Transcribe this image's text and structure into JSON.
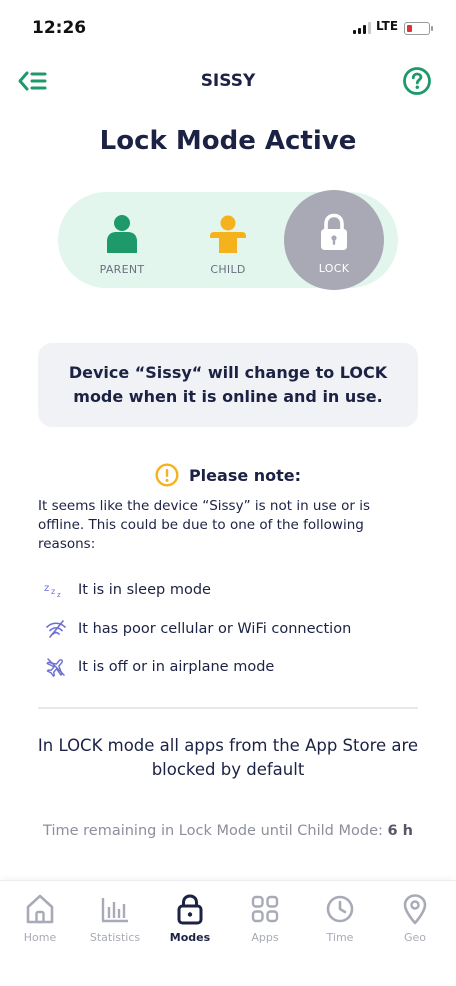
{
  "status_bar": {
    "time": "12:26",
    "network": "LTE"
  },
  "header": {
    "title": "SISSY",
    "back_icon": "menu-back-icon",
    "help_icon": "question-circle-icon"
  },
  "page_title": "Lock Mode Active",
  "modes": [
    {
      "label": "PARENT",
      "icon": "parent-person-icon",
      "color": "#1e9a6a"
    },
    {
      "label": "CHILD",
      "icon": "child-person-icon",
      "color": "#f5b21c"
    },
    {
      "label": "LOCK",
      "icon": "padlock-icon",
      "selected": true
    }
  ],
  "info_box": {
    "text": "Device “Sissy“ will change to LOCK mode when it is online and in use."
  },
  "note": {
    "title": "Please note:",
    "icon": "warning-circle-icon",
    "body": "It seems like the device “Sissy” is not in use or is offline. This could be due to one of the following reasons:",
    "reasons": [
      {
        "icon": "sleep-zzz-icon",
        "text": "It is in sleep mode"
      },
      {
        "icon": "no-wifi-icon",
        "text": "It has poor cellular or WiFi connection"
      },
      {
        "icon": "airplane-off-icon",
        "text": "It is off or in airplane mode"
      }
    ]
  },
  "lock_info": "In LOCK mode all apps from the App Store are blocked by default",
  "time_remaining": {
    "prefix": "Time remaining in Lock Mode until Child Mode: ",
    "value": "6 h"
  },
  "bottom_nav": [
    {
      "label": "Home",
      "icon": "home-icon"
    },
    {
      "label": "Statistics",
      "icon": "bar-chart-icon"
    },
    {
      "label": "Modes",
      "icon": "padlock-icon",
      "active": true
    },
    {
      "label": "Apps",
      "icon": "apps-grid-icon"
    },
    {
      "label": "Time",
      "icon": "clock-icon"
    },
    {
      "label": "Geo",
      "icon": "location-pin-icon"
    }
  ],
  "colors": {
    "accent": "#1e9a6a",
    "child": "#f5b21c",
    "warning": "#f5b21c",
    "text_dark": "#1c2244",
    "mode_track": "#e3f6ee",
    "lock_selected": "#a8a9b4"
  }
}
